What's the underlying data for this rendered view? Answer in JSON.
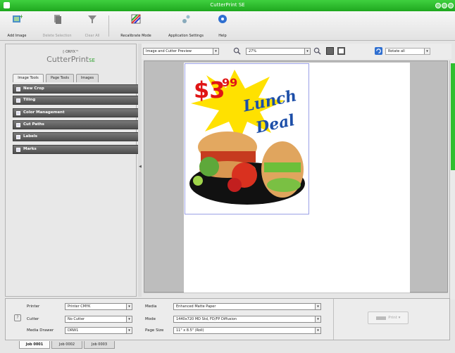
{
  "window": {
    "title": "CutterPrint SE"
  },
  "toolbar": {
    "add_image": "Add Image",
    "delete_selection": "Delete Selection",
    "clear_all": "Clear All",
    "recalibrate": "Recalibrate Mode",
    "app_settings": "Application Settings",
    "help": "Help"
  },
  "logo": {
    "brand": "◊ ONYX™",
    "product_prefix": "CutterPrint",
    "product_suffix": "SE"
  },
  "left_tabs": [
    "Image Tools",
    "Page Tools",
    "Images"
  ],
  "panels": [
    "New Crop",
    "Tiling",
    "Color Management",
    "Cut Paths",
    "Labels",
    "Marks"
  ],
  "view": {
    "mode": "Image and Cutter Preview",
    "zoom": "27%",
    "selection": "Rotate all"
  },
  "poster": {
    "price": "$3",
    "cents": "99",
    "line1": "Lunch",
    "line2": "Deal"
  },
  "settings": {
    "printer_label": "Printer",
    "printer_value": "Printer CMYK",
    "cutter_label": "Cutter",
    "cutter_value": "No Cutter",
    "media_drawer_label": "Media Drawer",
    "media_drawer_value": "DRW1",
    "media_label": "Media",
    "media_value": "Enhanced Matte Paper",
    "mode_label": "Mode",
    "mode_value": "1440x720 MD Std, FD/FP Diffusion",
    "page_size_label": "Page Size",
    "page_size_value": "11\" x 8.5\" (Roll)"
  },
  "print": {
    "label": "Print"
  },
  "jobs": [
    "Job 0001",
    "Job 0002",
    "Job 0003"
  ],
  "colors": {
    "accent": "#2fbf2f",
    "title_bar": "#22a822"
  }
}
